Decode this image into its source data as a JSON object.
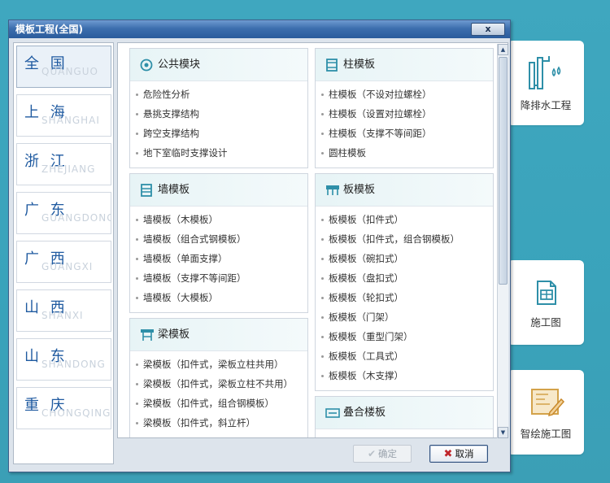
{
  "dialog": {
    "title": "模板工程(全国)",
    "close_label": "x",
    "ok_label": "确定",
    "cancel_label": "取消"
  },
  "regions": [
    {
      "label": "全 国",
      "watermark": "QUANGUO",
      "active": true
    },
    {
      "label": "上 海",
      "watermark": "SHANGHAI"
    },
    {
      "label": "浙 江",
      "watermark": "ZHEJIANG"
    },
    {
      "label": "广 东",
      "watermark": "GUANGDONG"
    },
    {
      "label": "广 西",
      "watermark": "GUANGXI"
    },
    {
      "label": "山 西",
      "watermark": "SHANXI"
    },
    {
      "label": "山 东",
      "watermark": "SHANDONG"
    },
    {
      "label": "重 庆",
      "watermark": "CHONGQING"
    }
  ],
  "cards": {
    "public": {
      "title": "公共模块",
      "items": [
        "危险性分析",
        "悬挑支撑结构",
        "跨空支撑结构",
        "地下室临时支撑设计"
      ]
    },
    "column": {
      "title": "柱模板",
      "items": [
        "柱模板（不设对拉螺栓）",
        "柱模板（设置对拉螺栓）",
        "柱模板（支撑不等间距）",
        "圆柱模板"
      ]
    },
    "wall": {
      "title": "墙模板",
      "items": [
        "墙模板（木模板）",
        "墙模板（组合式钢模板）",
        "墙模板（单面支撑）",
        "墙模板（支撑不等间距）",
        "墙模板（大模板）"
      ]
    },
    "slab": {
      "title": "板模板",
      "items": [
        "板模板（扣件式）",
        "板模板（扣件式，组合钢模板）",
        "板模板（碗扣式）",
        "板模板（盘扣式）",
        "板模板（轮扣式）",
        "板模板（门架）",
        "板模板（重型门架）",
        "板模板（工具式）",
        "板模板（木支撑）"
      ]
    },
    "beam": {
      "title": "梁模板",
      "items": [
        "梁模板（扣件式，梁板立柱共用）",
        "梁模板（扣件式，梁板立柱不共用）",
        "梁模板（扣件式，组合钢模板）",
        "梁模板（扣件式，斜立杆）"
      ]
    },
    "stack": {
      "title": "叠合楼板",
      "items": []
    }
  },
  "tiles": [
    {
      "label": "降排水工程",
      "icon": "drainage-icon"
    },
    {
      "label": "施工图",
      "icon": "construction-drawing-icon"
    },
    {
      "label": "智绘施工图",
      "icon": "smart-drawing-icon"
    }
  ],
  "colors": {
    "background": "#3fa7bf",
    "accent": "#1f5aa0",
    "tile_icon": "#2e8fa8",
    "titlebar": "#3d6fae"
  }
}
